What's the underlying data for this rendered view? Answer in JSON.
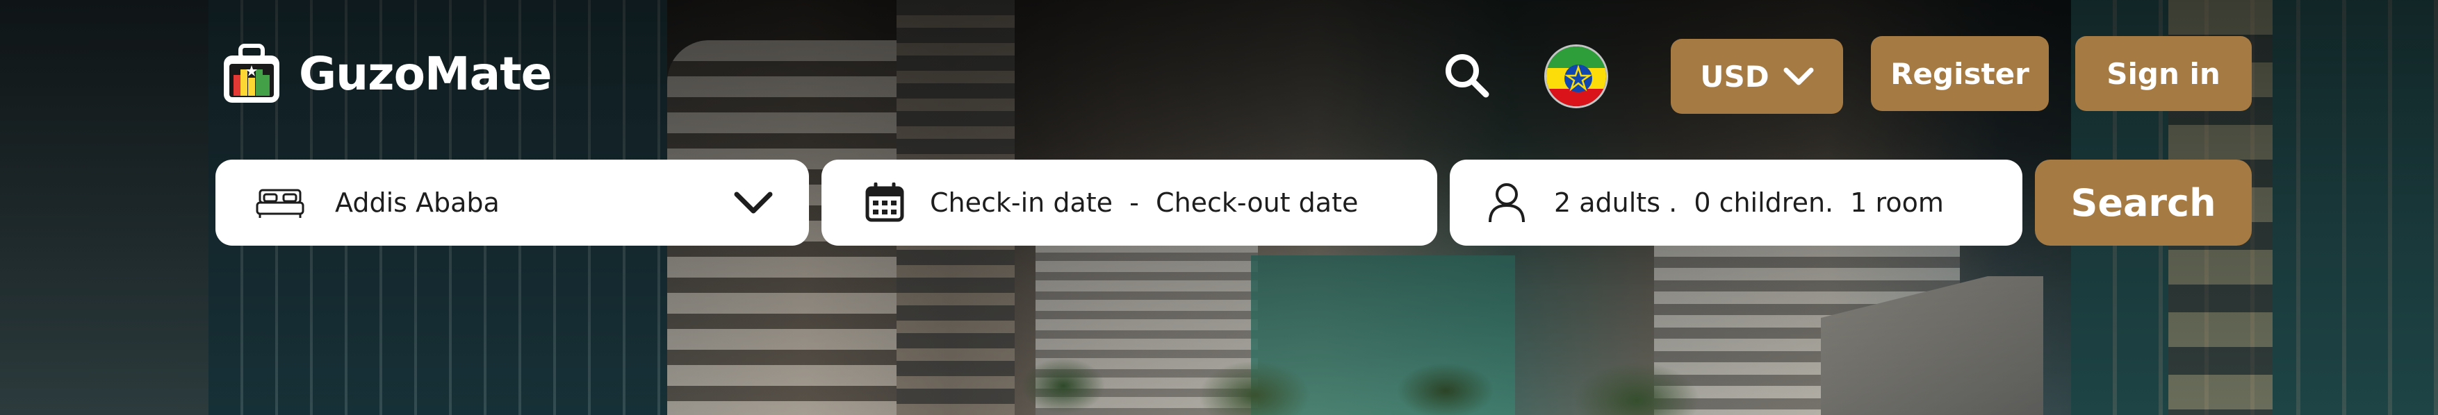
{
  "brand": {
    "name": "GuzoMate",
    "logo_icon": "hotel-suitcase-icon"
  },
  "header": {
    "search_icon": "search-icon",
    "language_flag": "ethiopia-flag-icon",
    "currency_label": "USD",
    "register_label": "Register",
    "signin_label": "Sign in"
  },
  "search_bar": {
    "destination": {
      "value": "Addis Ababa",
      "icon": "bed-icon"
    },
    "dates": {
      "value": "Check-in date  -  Check-out date",
      "icon": "calendar-icon"
    },
    "guests": {
      "value": "2 adults .  0 children.  1 room",
      "icon": "user-icon"
    },
    "submit_label": "Search"
  },
  "colors": {
    "accent": "#a57a43",
    "field_bg": "#ffffff",
    "text_dark": "#1d1d1d"
  }
}
